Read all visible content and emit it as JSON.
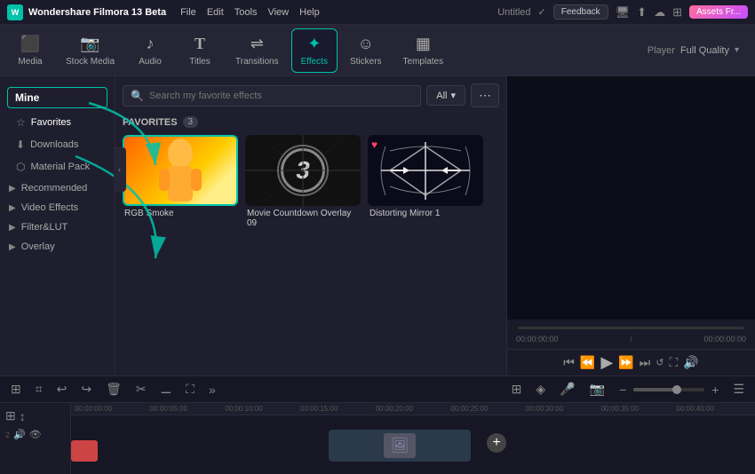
{
  "app": {
    "brand": "Wondershare Filmora 13 Beta",
    "title": "Untitled"
  },
  "menu": {
    "items": [
      "File",
      "Edit",
      "Tools",
      "View",
      "Help"
    ]
  },
  "header_right": {
    "feedback": "Feedback",
    "assets": "Assets Fr..."
  },
  "toolbar": {
    "items": [
      {
        "id": "media",
        "label": "Media",
        "icon": "⬛"
      },
      {
        "id": "stock-media",
        "label": "Stock Media",
        "icon": "🎬"
      },
      {
        "id": "audio",
        "label": "Audio",
        "icon": "🎵"
      },
      {
        "id": "titles",
        "label": "Titles",
        "icon": "T"
      },
      {
        "id": "transitions",
        "label": "Transitions",
        "icon": "↔"
      },
      {
        "id": "effects",
        "label": "Effects",
        "icon": "✨"
      },
      {
        "id": "stickers",
        "label": "Stickers",
        "icon": "⬡"
      },
      {
        "id": "templates",
        "label": "Templates",
        "icon": "📋"
      }
    ],
    "active": "effects"
  },
  "player": {
    "label": "Player",
    "quality": "Full Quality",
    "time_current": "00:00:00:00",
    "time_total": "00:00:00:00"
  },
  "sidebar": {
    "mine_label": "Mine",
    "items": [
      {
        "id": "favorites",
        "label": "Favorites",
        "icon": "★",
        "active": true
      },
      {
        "id": "downloads",
        "label": "Downloads",
        "icon": "⬇"
      },
      {
        "id": "material-pack",
        "label": "Material Pack",
        "icon": "⬡"
      },
      {
        "id": "recommended",
        "label": "Recommended",
        "icon": "▶"
      },
      {
        "id": "video-effects",
        "label": "Video Effects",
        "icon": "▶"
      },
      {
        "id": "filter-lut",
        "label": "Filter&LUT",
        "icon": "▶"
      },
      {
        "id": "overlay",
        "label": "Overlay",
        "icon": "▶"
      }
    ]
  },
  "effects": {
    "search_placeholder": "Search my favorite effects",
    "filter_label": "All",
    "favorites_label": "FAVORITES",
    "favorites_count": "3",
    "cards": [
      {
        "id": "rgb-smoke",
        "label": "RGB Smoke",
        "type": "rgb",
        "selected": true,
        "has_heart": false
      },
      {
        "id": "movie-countdown",
        "label": "Movie Countdown Overlay 09",
        "type": "countdown",
        "selected": false,
        "has_heart": true
      },
      {
        "id": "distorting-mirror",
        "label": "Distorting Mirror 1",
        "type": "distort",
        "selected": false,
        "has_heart": true
      }
    ]
  },
  "timeline": {
    "ruler_marks": [
      "00:00:00:00",
      "00:00:05:00",
      "00:00:10:00",
      "00:00:15:00",
      "00:00:20:00",
      "00:00:25:00",
      "00:00:30:00",
      "00:00:35:00",
      "00:00:40:00"
    ],
    "zoom_minus": "−",
    "zoom_plus": "+"
  }
}
